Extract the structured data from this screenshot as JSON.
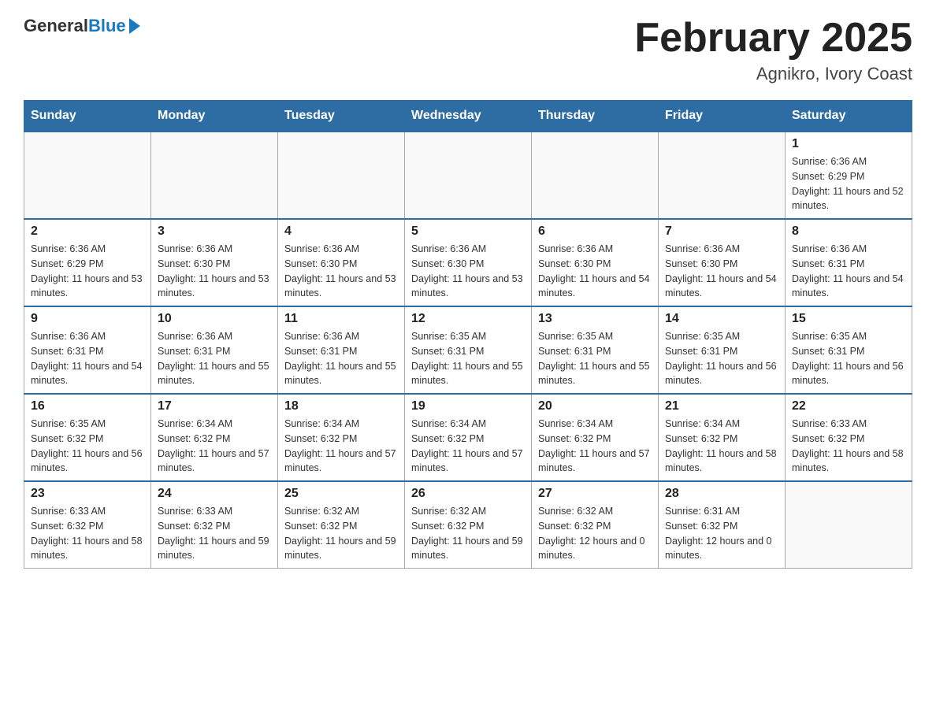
{
  "header": {
    "logo_general": "General",
    "logo_blue": "Blue",
    "month_title": "February 2025",
    "location": "Agnikro, Ivory Coast"
  },
  "days_of_week": [
    "Sunday",
    "Monday",
    "Tuesday",
    "Wednesday",
    "Thursday",
    "Friday",
    "Saturday"
  ],
  "weeks": [
    [
      {
        "day": "",
        "info": ""
      },
      {
        "day": "",
        "info": ""
      },
      {
        "day": "",
        "info": ""
      },
      {
        "day": "",
        "info": ""
      },
      {
        "day": "",
        "info": ""
      },
      {
        "day": "",
        "info": ""
      },
      {
        "day": "1",
        "info": "Sunrise: 6:36 AM\nSunset: 6:29 PM\nDaylight: 11 hours and 52 minutes."
      }
    ],
    [
      {
        "day": "2",
        "info": "Sunrise: 6:36 AM\nSunset: 6:29 PM\nDaylight: 11 hours and 53 minutes."
      },
      {
        "day": "3",
        "info": "Sunrise: 6:36 AM\nSunset: 6:30 PM\nDaylight: 11 hours and 53 minutes."
      },
      {
        "day": "4",
        "info": "Sunrise: 6:36 AM\nSunset: 6:30 PM\nDaylight: 11 hours and 53 minutes."
      },
      {
        "day": "5",
        "info": "Sunrise: 6:36 AM\nSunset: 6:30 PM\nDaylight: 11 hours and 53 minutes."
      },
      {
        "day": "6",
        "info": "Sunrise: 6:36 AM\nSunset: 6:30 PM\nDaylight: 11 hours and 54 minutes."
      },
      {
        "day": "7",
        "info": "Sunrise: 6:36 AM\nSunset: 6:30 PM\nDaylight: 11 hours and 54 minutes."
      },
      {
        "day": "8",
        "info": "Sunrise: 6:36 AM\nSunset: 6:31 PM\nDaylight: 11 hours and 54 minutes."
      }
    ],
    [
      {
        "day": "9",
        "info": "Sunrise: 6:36 AM\nSunset: 6:31 PM\nDaylight: 11 hours and 54 minutes."
      },
      {
        "day": "10",
        "info": "Sunrise: 6:36 AM\nSunset: 6:31 PM\nDaylight: 11 hours and 55 minutes."
      },
      {
        "day": "11",
        "info": "Sunrise: 6:36 AM\nSunset: 6:31 PM\nDaylight: 11 hours and 55 minutes."
      },
      {
        "day": "12",
        "info": "Sunrise: 6:35 AM\nSunset: 6:31 PM\nDaylight: 11 hours and 55 minutes."
      },
      {
        "day": "13",
        "info": "Sunrise: 6:35 AM\nSunset: 6:31 PM\nDaylight: 11 hours and 55 minutes."
      },
      {
        "day": "14",
        "info": "Sunrise: 6:35 AM\nSunset: 6:31 PM\nDaylight: 11 hours and 56 minutes."
      },
      {
        "day": "15",
        "info": "Sunrise: 6:35 AM\nSunset: 6:31 PM\nDaylight: 11 hours and 56 minutes."
      }
    ],
    [
      {
        "day": "16",
        "info": "Sunrise: 6:35 AM\nSunset: 6:32 PM\nDaylight: 11 hours and 56 minutes."
      },
      {
        "day": "17",
        "info": "Sunrise: 6:34 AM\nSunset: 6:32 PM\nDaylight: 11 hours and 57 minutes."
      },
      {
        "day": "18",
        "info": "Sunrise: 6:34 AM\nSunset: 6:32 PM\nDaylight: 11 hours and 57 minutes."
      },
      {
        "day": "19",
        "info": "Sunrise: 6:34 AM\nSunset: 6:32 PM\nDaylight: 11 hours and 57 minutes."
      },
      {
        "day": "20",
        "info": "Sunrise: 6:34 AM\nSunset: 6:32 PM\nDaylight: 11 hours and 57 minutes."
      },
      {
        "day": "21",
        "info": "Sunrise: 6:34 AM\nSunset: 6:32 PM\nDaylight: 11 hours and 58 minutes."
      },
      {
        "day": "22",
        "info": "Sunrise: 6:33 AM\nSunset: 6:32 PM\nDaylight: 11 hours and 58 minutes."
      }
    ],
    [
      {
        "day": "23",
        "info": "Sunrise: 6:33 AM\nSunset: 6:32 PM\nDaylight: 11 hours and 58 minutes."
      },
      {
        "day": "24",
        "info": "Sunrise: 6:33 AM\nSunset: 6:32 PM\nDaylight: 11 hours and 59 minutes."
      },
      {
        "day": "25",
        "info": "Sunrise: 6:32 AM\nSunset: 6:32 PM\nDaylight: 11 hours and 59 minutes."
      },
      {
        "day": "26",
        "info": "Sunrise: 6:32 AM\nSunset: 6:32 PM\nDaylight: 11 hours and 59 minutes."
      },
      {
        "day": "27",
        "info": "Sunrise: 6:32 AM\nSunset: 6:32 PM\nDaylight: 12 hours and 0 minutes."
      },
      {
        "day": "28",
        "info": "Sunrise: 6:31 AM\nSunset: 6:32 PM\nDaylight: 12 hours and 0 minutes."
      },
      {
        "day": "",
        "info": ""
      }
    ]
  ]
}
